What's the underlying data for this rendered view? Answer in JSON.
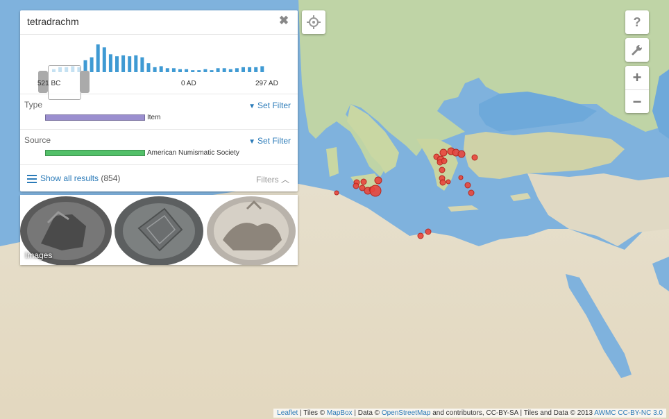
{
  "search": {
    "value": "tetradrachm",
    "clear_icon": "close-icon"
  },
  "timeline": {
    "start_label": "521 BC",
    "mid_label": "0 AD",
    "end_label": "297 AD",
    "histogram": [
      3,
      5,
      5,
      6,
      5,
      12,
      15,
      28,
      25,
      18,
      16,
      17,
      16,
      17,
      15,
      9,
      5,
      6,
      4,
      4,
      3,
      3,
      2,
      2,
      3,
      2,
      4,
      4,
      3,
      4,
      5,
      5,
      5,
      6
    ]
  },
  "facets": [
    {
      "title": "Type",
      "filter_label": "Set Filter",
      "value": "Item",
      "color": "#9b8fcf"
    },
    {
      "title": "Source",
      "filter_label": "Set Filter",
      "value": "American Numismatic Society",
      "color": "#53c069"
    }
  ],
  "results": {
    "label": "Show all results",
    "count": "(854)",
    "filters_label": "Filters"
  },
  "images": {
    "label": "Images"
  },
  "controls": {
    "help": "?",
    "zoom_in": "+",
    "zoom_out": "−"
  },
  "attribution": {
    "leaflet": "Leaflet",
    "tiles": " | Tiles © ",
    "mapbox": "MapBox",
    "data": " | Data © ",
    "osm": "OpenStreetMap",
    "rest": " and contributors, CC-BY-SA | Tiles and Data © 2013 ",
    "awmc": "AWMC",
    "license": "CC-BY-NC 3.0"
  },
  "colors": {
    "histogram_bar": "#3f9ad3",
    "marker": "#e8463c",
    "link": "#2a7ab8"
  }
}
